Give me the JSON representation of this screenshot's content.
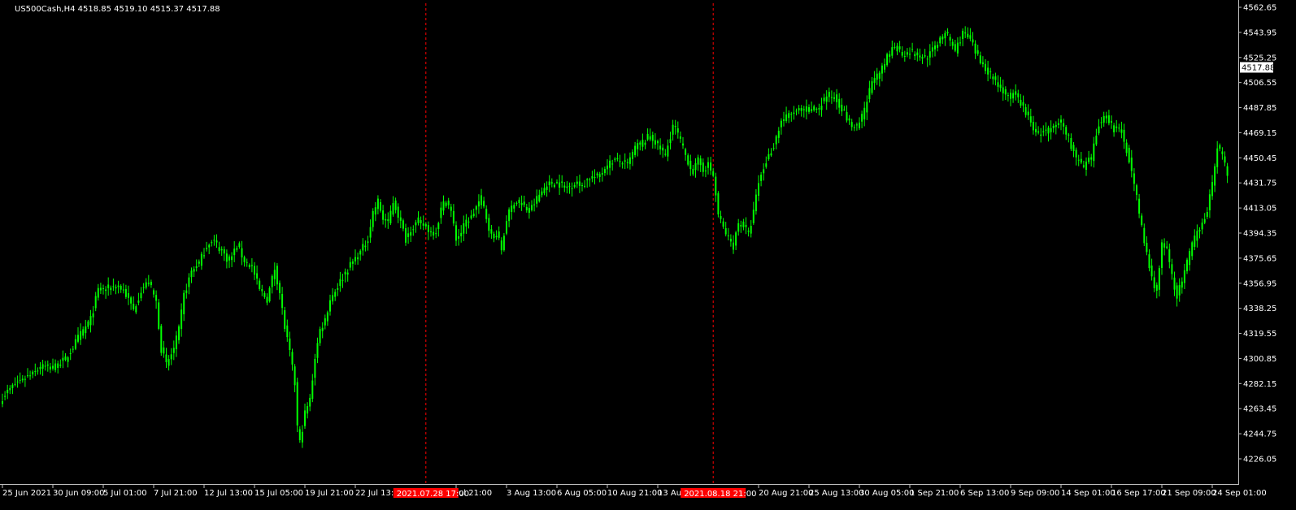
{
  "chart_data": {
    "type": "candlestick",
    "symbol_line": "US500Cash,H4  4518.85 4519.10 4515.37 4517.88",
    "current_price": "4517.88",
    "ylim": [
      4226.05,
      4562.65
    ],
    "y_ticks": [
      "4562.65",
      "4543.95",
      "4525.25",
      "4506.55",
      "4487.85",
      "4469.15",
      "4450.45",
      "4431.75",
      "4413.05",
      "4394.35",
      "4375.65",
      "4356.95",
      "4338.25",
      "4319.55",
      "4300.85",
      "4282.15",
      "4263.45",
      "4244.75",
      "4226.05"
    ],
    "x_ticks": [
      {
        "label": "25 Jun 2021",
        "bar": 0
      },
      {
        "label": "30 Jun 09:00",
        "bar": 20
      },
      {
        "label": "5 Jul 01:00",
        "bar": 40
      },
      {
        "label": "7 Jul 21:00",
        "bar": 60
      },
      {
        "label": "12 Jul 13:00",
        "bar": 80
      },
      {
        "label": "15 Jul 05:00",
        "bar": 100
      },
      {
        "label": "19 Jul 21:00",
        "bar": 120
      },
      {
        "label": "22 Jul 13:00",
        "bar": 140
      },
      {
        "label": "Jul 21:00",
        "bar": 180
      },
      {
        "label": "3 Aug 13:00",
        "bar": 200
      },
      {
        "label": "6 Aug 05:00",
        "bar": 220
      },
      {
        "label": "10 Aug 21:00",
        "bar": 240
      },
      {
        "label": "13 Aug 13:",
        "bar": 260
      },
      {
        "label": "20 Aug 21:00",
        "bar": 300
      },
      {
        "label": "25 Aug 13:00",
        "bar": 320
      },
      {
        "label": "30 Aug 05:00",
        "bar": 340
      },
      {
        "label": "1 Sep 21:00",
        "bar": 360
      },
      {
        "label": "6 Sep 13:00",
        "bar": 380
      },
      {
        "label": "9 Sep 09:00",
        "bar": 400
      },
      {
        "label": "14 Sep 01:00",
        "bar": 420
      },
      {
        "label": "16 Sep 17:00",
        "bar": 440
      },
      {
        "label": "21 Sep 09:00",
        "bar": 460
      },
      {
        "label": "24 Sep 01:00",
        "bar": 480
      }
    ],
    "markers": [
      {
        "label": "2021.07.28 17:00",
        "bar": 168
      },
      {
        "label": "2021.08.18 21:00",
        "bar": 282
      }
    ],
    "colors": {
      "background": "#000000",
      "candle": "#00ff00",
      "axis": "#c0c0c0",
      "text": "#ffffff",
      "marker": "#ff0000"
    },
    "close_keypoints": [
      [
        0,
        4272
      ],
      [
        5,
        4282
      ],
      [
        10,
        4288
      ],
      [
        15,
        4295
      ],
      [
        20,
        4294
      ],
      [
        25,
        4300
      ],
      [
        30,
        4316
      ],
      [
        35,
        4330
      ],
      [
        38,
        4352
      ],
      [
        42,
        4353
      ],
      [
        45,
        4355
      ],
      [
        48,
        4352
      ],
      [
        52,
        4337
      ],
      [
        55,
        4352
      ],
      [
        58,
        4358
      ],
      [
        61,
        4343
      ],
      [
        63,
        4308
      ],
      [
        65,
        4296
      ],
      [
        68,
        4308
      ],
      [
        70,
        4322
      ],
      [
        72,
        4348
      ],
      [
        75,
        4366
      ],
      [
        78,
        4372
      ],
      [
        81,
        4385
      ],
      [
        84,
        4388
      ],
      [
        87,
        4381
      ],
      [
        90,
        4373
      ],
      [
        93,
        4385
      ],
      [
        96,
        4374
      ],
      [
        99,
        4369
      ],
      [
        102,
        4352
      ],
      [
        105,
        4345
      ],
      [
        108,
        4368
      ],
      [
        110,
        4350
      ],
      [
        112,
        4324
      ],
      [
        114,
        4305
      ],
      [
        116,
        4282
      ],
      [
        117,
        4250
      ],
      [
        118,
        4238
      ],
      [
        120,
        4260
      ],
      [
        122,
        4270
      ],
      [
        124,
        4302
      ],
      [
        126,
        4322
      ],
      [
        128,
        4330
      ],
      [
        130,
        4345
      ],
      [
        133,
        4355
      ],
      [
        136,
        4365
      ],
      [
        139,
        4373
      ],
      [
        142,
        4380
      ],
      [
        145,
        4390
      ],
      [
        147,
        4410
      ],
      [
        149,
        4418
      ],
      [
        151,
        4405
      ],
      [
        153,
        4402
      ],
      [
        155,
        4418
      ],
      [
        157,
        4408
      ],
      [
        160,
        4390
      ],
      [
        162,
        4398
      ],
      [
        165,
        4403
      ],
      [
        168,
        4399
      ],
      [
        170,
        4395
      ],
      [
        172,
        4396
      ],
      [
        174,
        4412
      ],
      [
        176,
        4420
      ],
      [
        178,
        4410
      ],
      [
        180,
        4390
      ],
      [
        182,
        4395
      ],
      [
        184,
        4403
      ],
      [
        186,
        4406
      ],
      [
        188,
        4414
      ],
      [
        190,
        4420
      ],
      [
        192,
        4406
      ],
      [
        194,
        4392
      ],
      [
        196,
        4394
      ],
      [
        198,
        4382
      ],
      [
        200,
        4405
      ],
      [
        203,
        4418
      ],
      [
        206,
        4416
      ],
      [
        209,
        4410
      ],
      [
        212,
        4420
      ],
      [
        215,
        4428
      ],
      [
        218,
        4432
      ],
      [
        221,
        4431
      ],
      [
        224,
        4428
      ],
      [
        227,
        4432
      ],
      [
        230,
        4430
      ],
      [
        233,
        4436
      ],
      [
        236,
        4436
      ],
      [
        239,
        4443
      ],
      [
        242,
        4448
      ],
      [
        245,
        4448
      ],
      [
        248,
        4445
      ],
      [
        251,
        4458
      ],
      [
        254,
        4462
      ],
      [
        257,
        4467
      ],
      [
        260,
        4460
      ],
      [
        263,
        4452
      ],
      [
        266,
        4475
      ],
      [
        268,
        4468
      ],
      [
        270,
        4457
      ],
      [
        272,
        4448
      ],
      [
        274,
        4440
      ],
      [
        276,
        4448
      ],
      [
        278,
        4442
      ],
      [
        280,
        4445
      ],
      [
        282,
        4437
      ],
      [
        284,
        4408
      ],
      [
        286,
        4398
      ],
      [
        288,
        4390
      ],
      [
        290,
        4385
      ],
      [
        292,
        4402
      ],
      [
        294,
        4400
      ],
      [
        296,
        4393
      ],
      [
        298,
        4410
      ],
      [
        300,
        4432
      ],
      [
        303,
        4448
      ],
      [
        306,
        4460
      ],
      [
        309,
        4478
      ],
      [
        312,
        4482
      ],
      [
        315,
        4485
      ],
      [
        318,
        4486
      ],
      [
        321,
        4486
      ],
      [
        324,
        4488
      ],
      [
        327,
        4497
      ],
      [
        330,
        4496
      ],
      [
        333,
        4488
      ],
      [
        336,
        4476
      ],
      [
        339,
        4472
      ],
      [
        342,
        4485
      ],
      [
        345,
        4508
      ],
      [
        348,
        4512
      ],
      [
        351,
        4525
      ],
      [
        354,
        4535
      ],
      [
        357,
        4528
      ],
      [
        360,
        4530
      ],
      [
        363,
        4527
      ],
      [
        366,
        4525
      ],
      [
        369,
        4530
      ],
      [
        372,
        4540
      ],
      [
        375,
        4542
      ],
      [
        378,
        4530
      ],
      [
        381,
        4544
      ],
      [
        384,
        4538
      ],
      [
        387,
        4525
      ],
      [
        390,
        4518
      ],
      [
        393,
        4510
      ],
      [
        396,
        4503
      ],
      [
        399,
        4495
      ],
      [
        402,
        4498
      ],
      [
        405,
        4488
      ],
      [
        408,
        4476
      ],
      [
        411,
        4468
      ],
      [
        414,
        4470
      ],
      [
        417,
        4472
      ],
      [
        420,
        4478
      ],
      [
        423,
        4465
      ],
      [
        426,
        4450
      ],
      [
        429,
        4443
      ],
      [
        432,
        4450
      ],
      [
        435,
        4476
      ],
      [
        438,
        4482
      ],
      [
        441,
        4472
      ],
      [
        444,
        4470
      ],
      [
        447,
        4450
      ],
      [
        450,
        4420
      ],
      [
        453,
        4388
      ],
      [
        456,
        4360
      ],
      [
        458,
        4352
      ],
      [
        460,
        4385
      ],
      [
        462,
        4382
      ],
      [
        464,
        4362
      ],
      [
        466,
        4348
      ],
      [
        468,
        4358
      ],
      [
        470,
        4372
      ],
      [
        472,
        4385
      ],
      [
        474,
        4395
      ],
      [
        476,
        4402
      ],
      [
        478,
        4412
      ],
      [
        480,
        4430
      ],
      [
        482,
        4460
      ],
      [
        484,
        4452
      ],
      [
        486,
        4438
      ]
    ]
  }
}
